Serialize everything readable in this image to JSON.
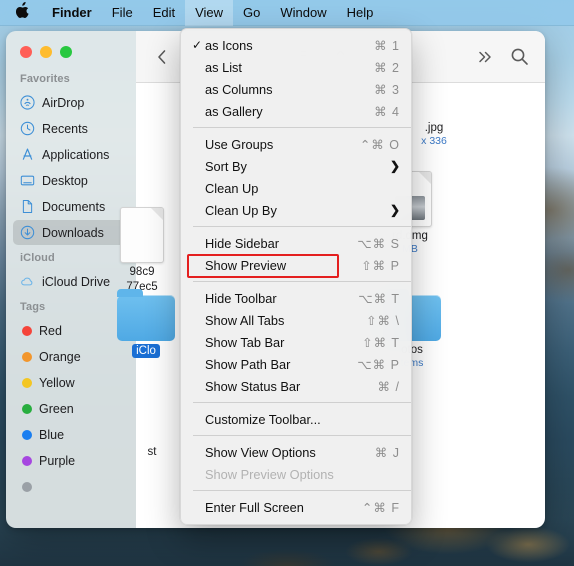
{
  "menubar": {
    "apple_icon": "apple-logo-icon",
    "items": [
      {
        "label": "Finder",
        "bold": true,
        "active": false
      },
      {
        "label": "File",
        "bold": false,
        "active": false
      },
      {
        "label": "Edit",
        "bold": false,
        "active": false
      },
      {
        "label": "View",
        "bold": false,
        "active": true
      },
      {
        "label": "Go",
        "bold": false,
        "active": false
      },
      {
        "label": "Window",
        "bold": false,
        "active": false
      },
      {
        "label": "Help",
        "bold": false,
        "active": false
      }
    ]
  },
  "window": {
    "traffic_lights": {
      "close_color": "#ff5f57",
      "minimize_color": "#febc2e",
      "maximize_color": "#28c840"
    },
    "toolbar": {
      "back_icon": "chevron-left-icon",
      "forward_icon": "chevron-right-icon",
      "view_sort_icon": "group-sort-icon",
      "stepper_icon": "chevron-up-down-icon",
      "overflow_icon": "double-chevron-right-icon",
      "search_icon": "search-icon"
    }
  },
  "sidebar": {
    "groups": [
      {
        "title": "Favorites",
        "items": [
          {
            "label": "AirDrop",
            "icon": "airdrop-icon",
            "selected": false
          },
          {
            "label": "Recents",
            "icon": "clock-icon",
            "selected": false
          },
          {
            "label": "Applications",
            "icon": "applications-icon",
            "selected": false
          },
          {
            "label": "Desktop",
            "icon": "desktop-icon",
            "selected": false
          },
          {
            "label": "Documents",
            "icon": "document-icon",
            "selected": false
          },
          {
            "label": "Downloads",
            "icon": "downloads-icon",
            "selected": true
          }
        ]
      },
      {
        "title": "iCloud",
        "items": [
          {
            "label": "iCloud Drive",
            "icon": "cloud-icon",
            "selected": false
          }
        ]
      },
      {
        "title": "Tags",
        "items": [
          {
            "label": "Red",
            "icon": "tag-dot",
            "color": "#f5443a",
            "selected": false
          },
          {
            "label": "Orange",
            "icon": "tag-dot",
            "color": "#f2962c",
            "selected": false
          },
          {
            "label": "Yellow",
            "icon": "tag-dot",
            "color": "#f3c623",
            "selected": false
          },
          {
            "label": "Green",
            "icon": "tag-dot",
            "color": "#28ae3f",
            "selected": false
          },
          {
            "label": "Blue",
            "icon": "tag-dot",
            "color": "#1a7ef0",
            "selected": false
          },
          {
            "label": "Purple",
            "icon": "tag-dot",
            "color": "#a646e0",
            "selected": false
          },
          {
            "label": "",
            "icon": "tag-dot",
            "color": "#9aa0a6",
            "selected": false
          }
        ]
      }
    ]
  },
  "content": {
    "files": [
      {
        "name": "98c9\n77ec5",
        "name_line1": "98c9",
        "name_line2": "77ec5",
        "meta": "",
        "icon": "document-icon",
        "selected": false
      },
      {
        "name": ".jpg",
        "meta": "x 336",
        "icon": "image-icon",
        "selected": false
      },
      {
        "name": "rd.dmg",
        "meta": "MB",
        "icon": "dmg-icon",
        "selected": false
      },
      {
        "name": "iClo",
        "meta": "",
        "icon": "folder-icon",
        "selected": true
      },
      {
        "name": "otos",
        "meta": "tems",
        "icon": "folder-icon",
        "selected": false
      },
      {
        "name": "st",
        "meta": "",
        "icon": "document-icon",
        "selected": false
      }
    ]
  },
  "view_menu": {
    "sections": [
      {
        "rows": [
          {
            "label": "as Icons",
            "shortcut": "⌘ 1",
            "checked": true,
            "submenu": false,
            "disabled": false
          },
          {
            "label": "as List",
            "shortcut": "⌘ 2",
            "checked": false,
            "submenu": false,
            "disabled": false
          },
          {
            "label": "as Columns",
            "shortcut": "⌘ 3",
            "checked": false,
            "submenu": false,
            "disabled": false
          },
          {
            "label": "as Gallery",
            "shortcut": "⌘ 4",
            "checked": false,
            "submenu": false,
            "disabled": false
          }
        ]
      },
      {
        "rows": [
          {
            "label": "Use Groups",
            "shortcut": "⌃⌘ O",
            "checked": false,
            "submenu": false,
            "disabled": false
          },
          {
            "label": "Sort By",
            "shortcut": "",
            "checked": false,
            "submenu": true,
            "disabled": false
          },
          {
            "label": "Clean Up",
            "shortcut": "",
            "checked": false,
            "submenu": false,
            "disabled": false
          },
          {
            "label": "Clean Up By",
            "shortcut": "",
            "checked": false,
            "submenu": true,
            "disabled": false
          }
        ]
      },
      {
        "rows": [
          {
            "label": "Hide Sidebar",
            "shortcut": "⌥⌘ S",
            "checked": false,
            "submenu": false,
            "disabled": false
          },
          {
            "label": "Show Preview",
            "shortcut": "⇧⌘ P",
            "checked": false,
            "submenu": false,
            "disabled": false,
            "highlighted": true
          }
        ]
      },
      {
        "rows": [
          {
            "label": "Hide Toolbar",
            "shortcut": "⌥⌘ T",
            "checked": false,
            "submenu": false,
            "disabled": false
          },
          {
            "label": "Show All Tabs",
            "shortcut": "⇧⌘ \\",
            "checked": false,
            "submenu": false,
            "disabled": false
          },
          {
            "label": "Show Tab Bar",
            "shortcut": "⇧⌘ T",
            "checked": false,
            "submenu": false,
            "disabled": false
          },
          {
            "label": "Show Path Bar",
            "shortcut": "⌥⌘ P",
            "checked": false,
            "submenu": false,
            "disabled": false
          },
          {
            "label": "Show Status Bar",
            "shortcut": "⌘ /",
            "checked": false,
            "submenu": false,
            "disabled": false
          }
        ]
      },
      {
        "rows": [
          {
            "label": "Customize Toolbar...",
            "shortcut": "",
            "checked": false,
            "submenu": false,
            "disabled": false
          }
        ]
      },
      {
        "rows": [
          {
            "label": "Show View Options",
            "shortcut": "⌘ J",
            "checked": false,
            "submenu": false,
            "disabled": false
          },
          {
            "label": "Show Preview Options",
            "shortcut": "",
            "checked": false,
            "submenu": false,
            "disabled": true
          }
        ]
      },
      {
        "rows": [
          {
            "label": "Enter Full Screen",
            "shortcut": "⌃⌘ F",
            "checked": false,
            "submenu": false,
            "disabled": false
          }
        ]
      }
    ]
  },
  "annotation": {
    "highlight_color": "#e41f1f",
    "target_label": "Show Preview"
  }
}
